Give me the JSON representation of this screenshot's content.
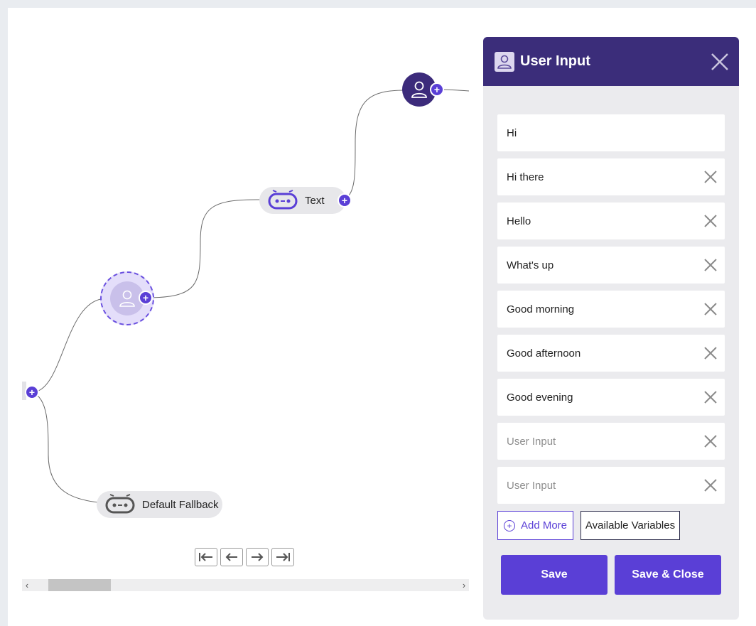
{
  "canvas": {
    "nodes": {
      "text_node_label": "Text",
      "fallback_node_label": "Default Fallback"
    },
    "add_glyph": "+",
    "scroll": {
      "left_arrow": "‹",
      "right_arrow": "›"
    }
  },
  "panel": {
    "title": "User Input",
    "inputs": [
      {
        "value": "Hi",
        "placeholder": "User Input"
      },
      {
        "value": "Hi there",
        "placeholder": "User Input"
      },
      {
        "value": "Hello",
        "placeholder": "User Input"
      },
      {
        "value": "What's up",
        "placeholder": "User Input"
      },
      {
        "value": "Good morning",
        "placeholder": "User Input"
      },
      {
        "value": "Good afternoon",
        "placeholder": "User Input"
      },
      {
        "value": "Good evening",
        "placeholder": "User Input"
      },
      {
        "value": "",
        "placeholder": "User Input"
      },
      {
        "value": "",
        "placeholder": "User Input"
      }
    ],
    "add_more_label": "Add More",
    "available_variables_label": "Available Variables",
    "save_label": "Save",
    "save_close_label": "Save & Close"
  },
  "colors": {
    "accent": "#5a3fd6",
    "header": "#3b2d7a",
    "panel_bg": "#ebebee"
  }
}
